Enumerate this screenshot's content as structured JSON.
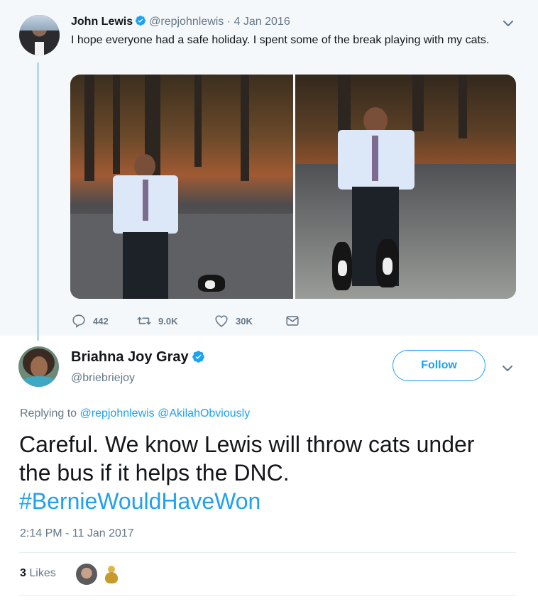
{
  "parent_tweet": {
    "author_name": "John Lewis",
    "handle": "@repjohnlewis",
    "separator": "·",
    "date": "4 Jan 2016",
    "text": "I hope everyone had a safe holiday. I spent some of the break playing with my cats.",
    "actions": {
      "replies": "442",
      "retweets": "9.0K",
      "likes": "30K"
    }
  },
  "reply_tweet": {
    "author_name": "Briahna Joy Gray",
    "handle": "@briebriejoy",
    "follow_label": "Follow",
    "replying_prefix": "Replying to",
    "replying_to": [
      "@repjohnlewis",
      "@AkilahObviously"
    ],
    "text_line1": "Careful. We know Lewis will throw cats under",
    "text_line2": "the bus if it helps the DNC.",
    "hashtag": "#BernieWouldHaveWon",
    "timestamp": "2:14 PM - 11 Jan 2017",
    "likes_count": "3",
    "likes_label": "Likes"
  },
  "colors": {
    "accent": "#1da1f2",
    "secondary_text": "#657786",
    "parent_background": "#f5f8fa",
    "thread_line": "#b7d8ef"
  },
  "icons": [
    "verified-badge-icon",
    "chevron-down-icon",
    "reply-icon",
    "retweet-icon",
    "like-heart-icon",
    "direct-message-icon"
  ]
}
